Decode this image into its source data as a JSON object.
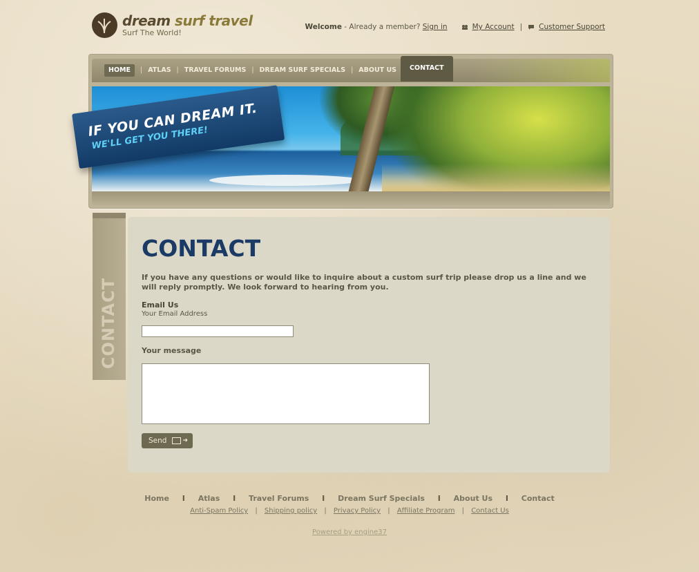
{
  "brand": {
    "name_part1": "dream",
    "name_part2": " surf travel",
    "tagline": "Surf The World!"
  },
  "topbar": {
    "welcome": "Welcome",
    "already_member": " - Already a member? ",
    "sign_in": "Sign in",
    "my_account": "My Account",
    "separator": "|",
    "customer_support": "Customer Support"
  },
  "nav": {
    "items": [
      "HOME",
      "ATLAS",
      "TRAVEL FORUMS",
      "DREAM SURF SPECIALS",
      "ABOUT US",
      "CONTACT"
    ],
    "active": "CONTACT",
    "divider": "|"
  },
  "hero": {
    "line1": "IF YOU CAN DREAM IT.",
    "line2": "WE'LL GET YOU THERE!"
  },
  "sidetab": {
    "label": "CONTACT"
  },
  "content": {
    "title": "CONTACT",
    "intro": "If you have any questions or would like to inquire about a custom surf trip please drop us a line and we will reply promptly. We look forward to hearing from you.",
    "email_title": "Email Us",
    "email_label": "Your Email Address",
    "email_value": "",
    "message_label": "Your message",
    "message_value": "",
    "send_label": "Send"
  },
  "footer": {
    "nav": [
      "Home",
      "Atlas",
      "Travel Forums",
      "Dream Surf Specials",
      "About Us",
      "Contact"
    ],
    "nav_separator": "I",
    "links": [
      "Anti-Spam Policy",
      "Shipping policy",
      "Privacy Policy",
      "Affiliate Program",
      "Contact Us"
    ],
    "links_separator": "|",
    "powered": "Powered by engine37"
  },
  "colors": {
    "background": "#e8dcc2",
    "nav": "#8f876c",
    "nav_active": "#5f5a44",
    "title": "#1c3a66",
    "panel": "#dcd8c7",
    "button": "#6e6a52"
  }
}
